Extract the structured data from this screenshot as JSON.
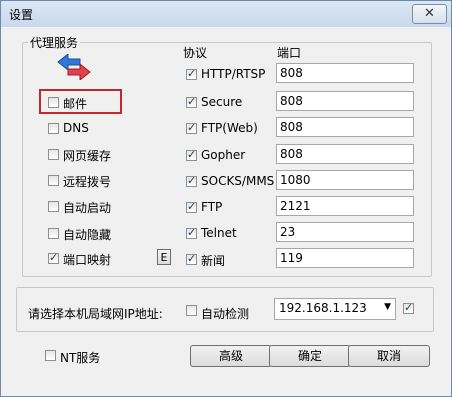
{
  "window": {
    "title": "设置",
    "close_glyph": "✕"
  },
  "proxy_group": {
    "title": "代理服务",
    "col_protocol": "协议",
    "col_port": "端口",
    "services": [
      {
        "label": "邮件",
        "checked": false
      },
      {
        "label": "DNS",
        "checked": false
      },
      {
        "label": "网页缓存",
        "checked": false
      },
      {
        "label": "远程拨号",
        "checked": false
      },
      {
        "label": "自动启动",
        "checked": false
      },
      {
        "label": "自动隐藏",
        "checked": false
      },
      {
        "label": "端口映射",
        "checked": true
      }
    ],
    "e_button": "E",
    "protocols": [
      {
        "label": "HTTP/RTSP",
        "checked": true,
        "port": "808"
      },
      {
        "label": "Secure",
        "checked": true,
        "port": "808"
      },
      {
        "label": "FTP(Web)",
        "checked": true,
        "port": "808"
      },
      {
        "label": "Gopher",
        "checked": true,
        "port": "808"
      },
      {
        "label": "SOCKS/MMS",
        "checked": true,
        "port": "1080"
      },
      {
        "label": "FTP",
        "checked": true,
        "port": "2121"
      },
      {
        "label": "Telnet",
        "checked": true,
        "port": "23"
      },
      {
        "label": "新闻",
        "checked": true,
        "port": "119"
      }
    ]
  },
  "lan": {
    "label": "请选择本机局域网IP地址:",
    "auto_detect": "自动检测",
    "auto_detect_checked": false,
    "ip_selected": "192.168.1.123",
    "extra_checked": true
  },
  "footer": {
    "nt_service": "NT服务",
    "nt_checked": false,
    "advanced": "高级",
    "ok": "确定",
    "cancel": "取消"
  },
  "colors": {
    "highlight": "#c0282a",
    "arrow_blue": "#2f7ad8",
    "arrow_red": "#e0414a"
  },
  "icons": {
    "transfer": "transfer-arrows-icon"
  }
}
